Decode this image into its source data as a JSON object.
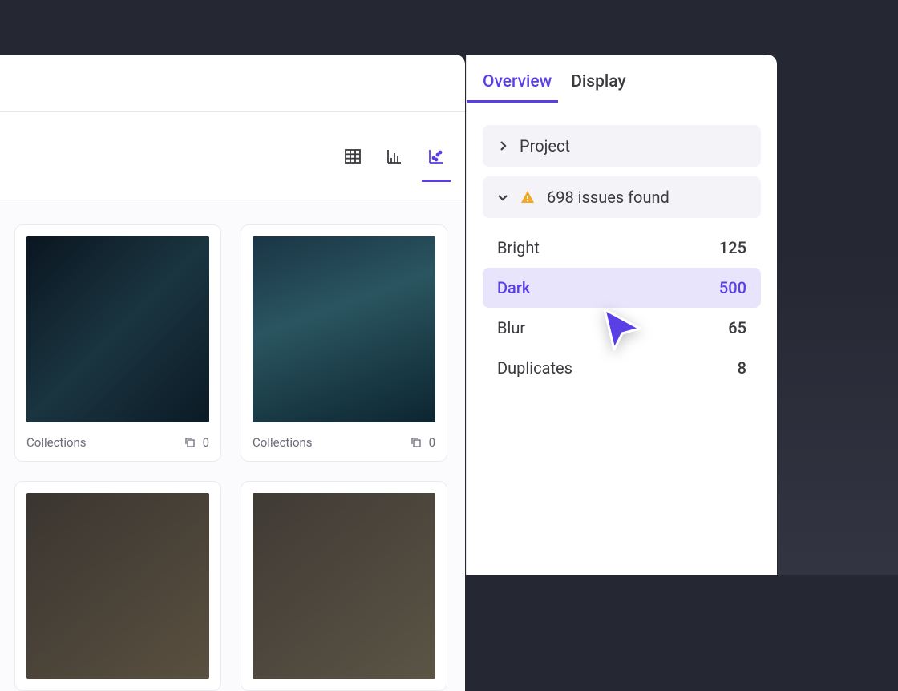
{
  "tabs": {
    "overview": "Overview",
    "display": "Display"
  },
  "project_section": {
    "label": "Project"
  },
  "issues_section": {
    "label": "698 issues found"
  },
  "issues": [
    {
      "name": "Bright",
      "count": "125"
    },
    {
      "name": "Dark",
      "count": "500"
    },
    {
      "name": "Blur",
      "count": "65"
    },
    {
      "name": "Duplicates",
      "count": "8"
    }
  ],
  "card": {
    "label": "Collections",
    "count": "0"
  }
}
